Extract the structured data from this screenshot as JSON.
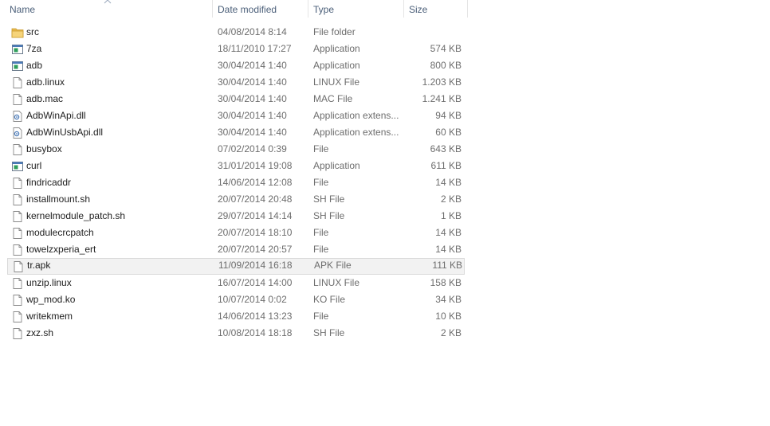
{
  "columns": {
    "name": "Name",
    "date": "Date modified",
    "type": "Type",
    "size": "Size"
  },
  "sort": {
    "column": "name",
    "direction": "ascending"
  },
  "colors": {
    "header_text": "#4c607a",
    "folder": "#e8b84a",
    "hover_bg": "#f2f2f2"
  },
  "files": [
    {
      "name": "src",
      "date": "04/08/2014 8:14",
      "type": "File folder",
      "size": "",
      "icon": "folder-icon"
    },
    {
      "name": "7za",
      "date": "18/11/2010 17:27",
      "type": "Application",
      "size": "574 KB",
      "icon": "application-icon"
    },
    {
      "name": "adb",
      "date": "30/04/2014 1:40",
      "type": "Application",
      "size": "800 KB",
      "icon": "application-icon"
    },
    {
      "name": "adb.linux",
      "date": "30/04/2014 1:40",
      "type": "LINUX File",
      "size": "1.203 KB",
      "icon": "file-icon"
    },
    {
      "name": "adb.mac",
      "date": "30/04/2014 1:40",
      "type": "MAC File",
      "size": "1.241 KB",
      "icon": "file-icon"
    },
    {
      "name": "AdbWinApi.dll",
      "date": "30/04/2014 1:40",
      "type": "Application extens...",
      "size": "94 KB",
      "icon": "dll-icon"
    },
    {
      "name": "AdbWinUsbApi.dll",
      "date": "30/04/2014 1:40",
      "type": "Application extens...",
      "size": "60 KB",
      "icon": "dll-icon"
    },
    {
      "name": "busybox",
      "date": "07/02/2014 0:39",
      "type": "File",
      "size": "643 KB",
      "icon": "file-icon"
    },
    {
      "name": "curl",
      "date": "31/01/2014 19:08",
      "type": "Application",
      "size": "611 KB",
      "icon": "application-icon"
    },
    {
      "name": "findricaddr",
      "date": "14/06/2014 12:08",
      "type": "File",
      "size": "14 KB",
      "icon": "file-icon"
    },
    {
      "name": "installmount.sh",
      "date": "20/07/2014 20:48",
      "type": "SH File",
      "size": "2 KB",
      "icon": "file-icon"
    },
    {
      "name": "kernelmodule_patch.sh",
      "date": "29/07/2014 14:14",
      "type": "SH File",
      "size": "1 KB",
      "icon": "file-icon"
    },
    {
      "name": "modulecrcpatch",
      "date": "20/07/2014 18:10",
      "type": "File",
      "size": "14 KB",
      "icon": "file-icon"
    },
    {
      "name": "towelzxperia_ert",
      "date": "20/07/2014 20:57",
      "type": "File",
      "size": "14 KB",
      "icon": "file-icon"
    },
    {
      "name": "tr.apk",
      "date": "11/09/2014 16:18",
      "type": "APK File",
      "size": "111 KB",
      "icon": "file-icon",
      "hover": true
    },
    {
      "name": "unzip.linux",
      "date": "16/07/2014 14:00",
      "type": "LINUX File",
      "size": "158 KB",
      "icon": "file-icon"
    },
    {
      "name": "wp_mod.ko",
      "date": "10/07/2014 0:02",
      "type": "KO File",
      "size": "34 KB",
      "icon": "file-icon"
    },
    {
      "name": "writekmem",
      "date": "14/06/2014 13:23",
      "type": "File",
      "size": "10 KB",
      "icon": "file-icon"
    },
    {
      "name": "zxz.sh",
      "date": "10/08/2014 18:18",
      "type": "SH File",
      "size": "2 KB",
      "icon": "file-icon"
    }
  ]
}
